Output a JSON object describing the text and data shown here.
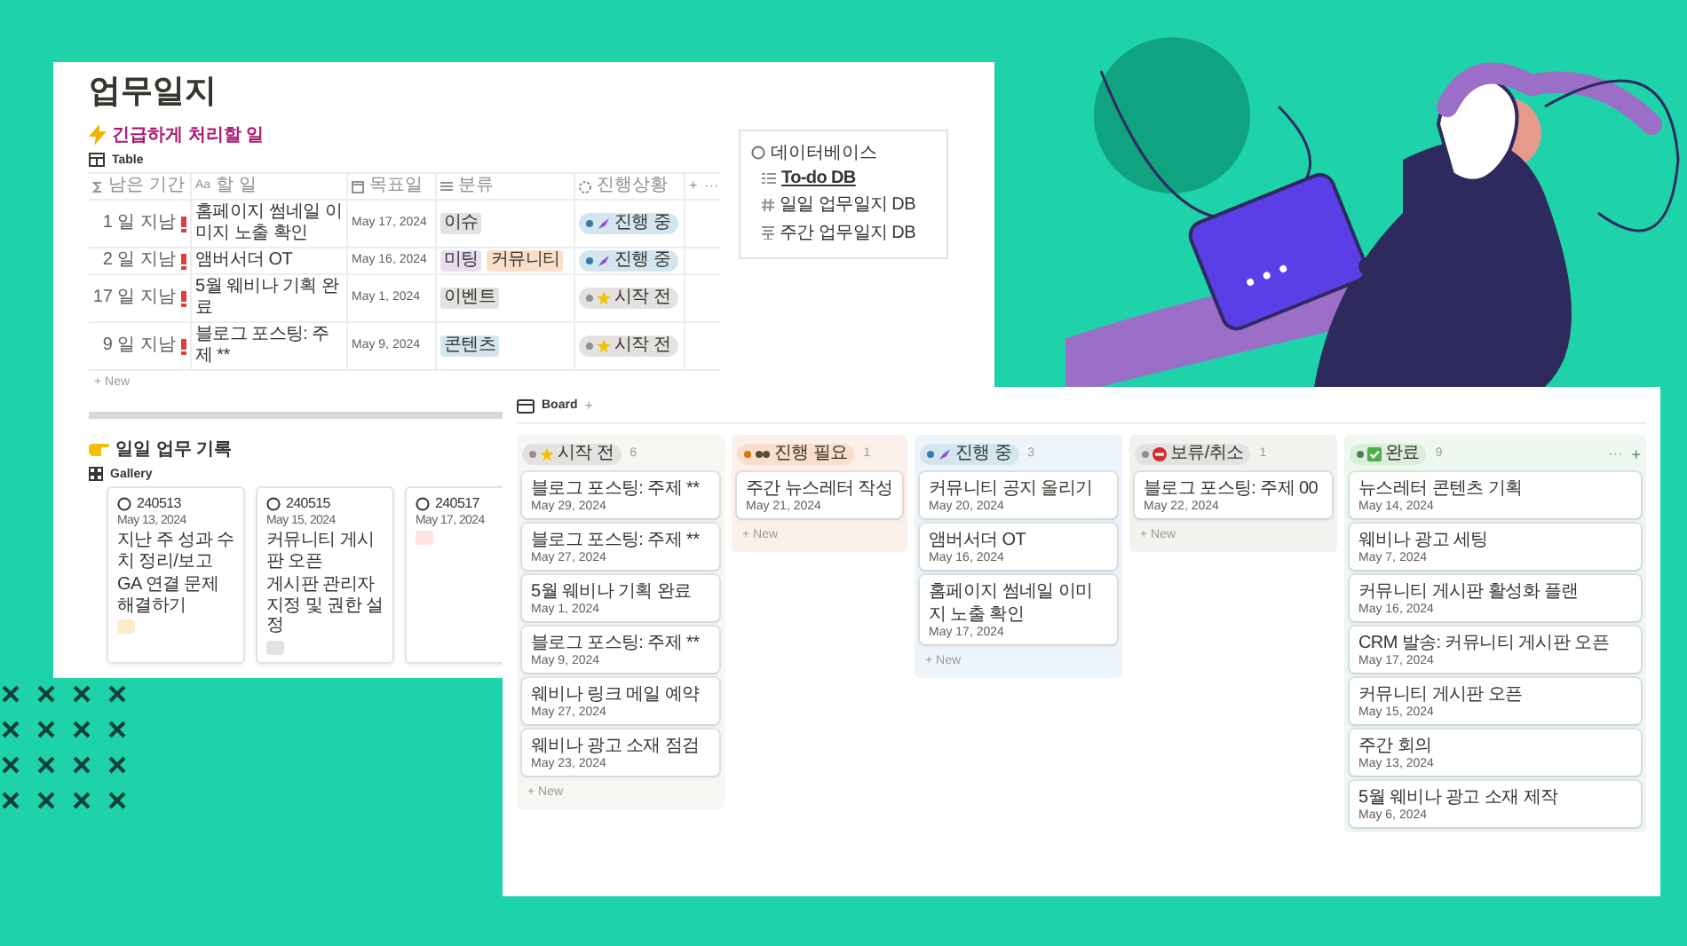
{
  "page": {
    "title": "업무일지"
  },
  "urgent": {
    "heading": "긴급하게 처리할 일",
    "view": "Table",
    "add_column": "+",
    "more": "···",
    "new": "+ New",
    "columns": [
      {
        "label": "남은 기간",
        "kind": "formula"
      },
      {
        "label": "할 일",
        "kind": "title",
        "prefix": "Aa"
      },
      {
        "label": "목표일",
        "kind": "date"
      },
      {
        "label": "분류",
        "kind": "multi"
      },
      {
        "label": "진행상황",
        "kind": "status"
      }
    ],
    "rows": [
      {
        "remaining": "1 일 지남",
        "overdue": true,
        "task": "홈페이지 썸네일 이미지 노출 확인",
        "date": "May 17, 2024",
        "tags": [
          {
            "label": "이슈",
            "color": "#e3e2e0"
          }
        ],
        "status": {
          "label": "진행 중",
          "kind": "in_progress"
        }
      },
      {
        "remaining": "2 일 지남",
        "overdue": true,
        "task": "앰버서더 OT",
        "date": "May 16, 2024",
        "tags": [
          {
            "label": "미팅",
            "color": "#e8deee"
          },
          {
            "label": "커뮤니티",
            "color": "#fadec9"
          }
        ],
        "status": {
          "label": "진행 중",
          "kind": "in_progress"
        }
      },
      {
        "remaining": "17 일 지남",
        "overdue": true,
        "task": "5월 웨비나 기획 완료",
        "date": "May 1, 2024",
        "tags": [
          {
            "label": "이벤트",
            "color": "#e3e2e0"
          }
        ],
        "status": {
          "label": "시작 전",
          "kind": "not_started"
        }
      },
      {
        "remaining": "9 일 지남",
        "overdue": true,
        "task": "블로그 포스팅: 주제 **",
        "date": "May 9, 2024",
        "tags": [
          {
            "label": "콘텐츠",
            "color": "#d3e5ef"
          }
        ],
        "status": {
          "label": "시작 전",
          "kind": "not_started"
        }
      }
    ]
  },
  "databases": {
    "heading": "데이터베이스",
    "items": [
      {
        "label": "To-do DB",
        "kind": "list",
        "link": true
      },
      {
        "label": "일일 업무일지 DB",
        "kind": "hash",
        "link": false
      },
      {
        "label": "주간 업무일지 DB",
        "kind": "stack",
        "link": false
      }
    ]
  },
  "daily": {
    "heading": "일일 업무 기록",
    "view": "Gallery",
    "cards": [
      {
        "id": "240513",
        "date": "May 13, 2024",
        "lines": [
          "지난 주 성과 수치 정리/보고",
          "GA 연결 문제 해결하기"
        ],
        "color": "#fdecc8"
      },
      {
        "id": "240515",
        "date": "May 15, 2024",
        "lines": [
          "커뮤니티 게시판 오픈",
          "게시판 관리자 지정 및 권한 설정"
        ],
        "color": "#e3e2e0"
      },
      {
        "id": "240517",
        "date": "May 17, 2024",
        "color": "#ffe2dd"
      }
    ]
  },
  "board": {
    "view": "Board",
    "add": "+",
    "columns": [
      {
        "status": {
          "label": "시작 전",
          "kind": "not_started"
        },
        "count": "6",
        "new": "+ New",
        "cards": [
          {
            "title": "블로그 포스팅: 주제 **",
            "date": "May 29, 2024"
          },
          {
            "title": "블로그 포스팅: 주제 **",
            "date": "May 27, 2024"
          },
          {
            "title": "5월 웨비나 기획 완료",
            "date": "May 1, 2024"
          },
          {
            "title": "블로그 포스팅: 주제 **",
            "date": "May 9, 2024"
          },
          {
            "title": "웨비나 링크 메일 예약",
            "date": "May 27, 2024"
          },
          {
            "title": "웨비나 광고 소재 점검",
            "date": "May 23, 2024"
          }
        ]
      },
      {
        "status": {
          "label": "진행 필요",
          "kind": "needed"
        },
        "count": "1",
        "new": "+ New",
        "cards": [
          {
            "title": "주간 뉴스레터 작성",
            "date": "May 21, 2024"
          }
        ]
      },
      {
        "status": {
          "label": "진행 중",
          "kind": "in_progress"
        },
        "count": "3",
        "new": "+ New",
        "cards": [
          {
            "title": "커뮤니티 공지 올리기",
            "date": "May 20, 2024"
          },
          {
            "title": "앰버서더 OT",
            "date": "May 16, 2024"
          },
          {
            "title": "홈페이지 썸네일 이미지 노출 확인",
            "date": "May 17, 2024"
          }
        ]
      },
      {
        "status": {
          "label": "보류/취소",
          "kind": "on_hold"
        },
        "count": "1",
        "new": "+ New",
        "cards": [
          {
            "title": "블로그 포스팅: 주제 00",
            "date": "May 22, 2024"
          }
        ]
      },
      {
        "status": {
          "label": "완료",
          "kind": "done"
        },
        "count": "9",
        "menu": "···",
        "add": "+",
        "cards": [
          {
            "title": "뉴스레터 콘텐츠 기획",
            "date": "May 14, 2024"
          },
          {
            "title": "웨비나 광고 세팅",
            "date": "May 7, 2024"
          },
          {
            "title": "커뮤니티 게시판 활성화 플랜",
            "date": "May 16, 2024"
          },
          {
            "title": "CRM 발송: 커뮤니티 게시판 오픈",
            "date": "May 17, 2024"
          },
          {
            "title": "커뮤니티 게시판 오픈",
            "date": "May 15, 2024"
          },
          {
            "title": "주간 회의",
            "date": "May 13, 2024"
          },
          {
            "title": "5월 웨비나 광고 소재 제작",
            "date": "May 6, 2024"
          }
        ]
      }
    ]
  }
}
